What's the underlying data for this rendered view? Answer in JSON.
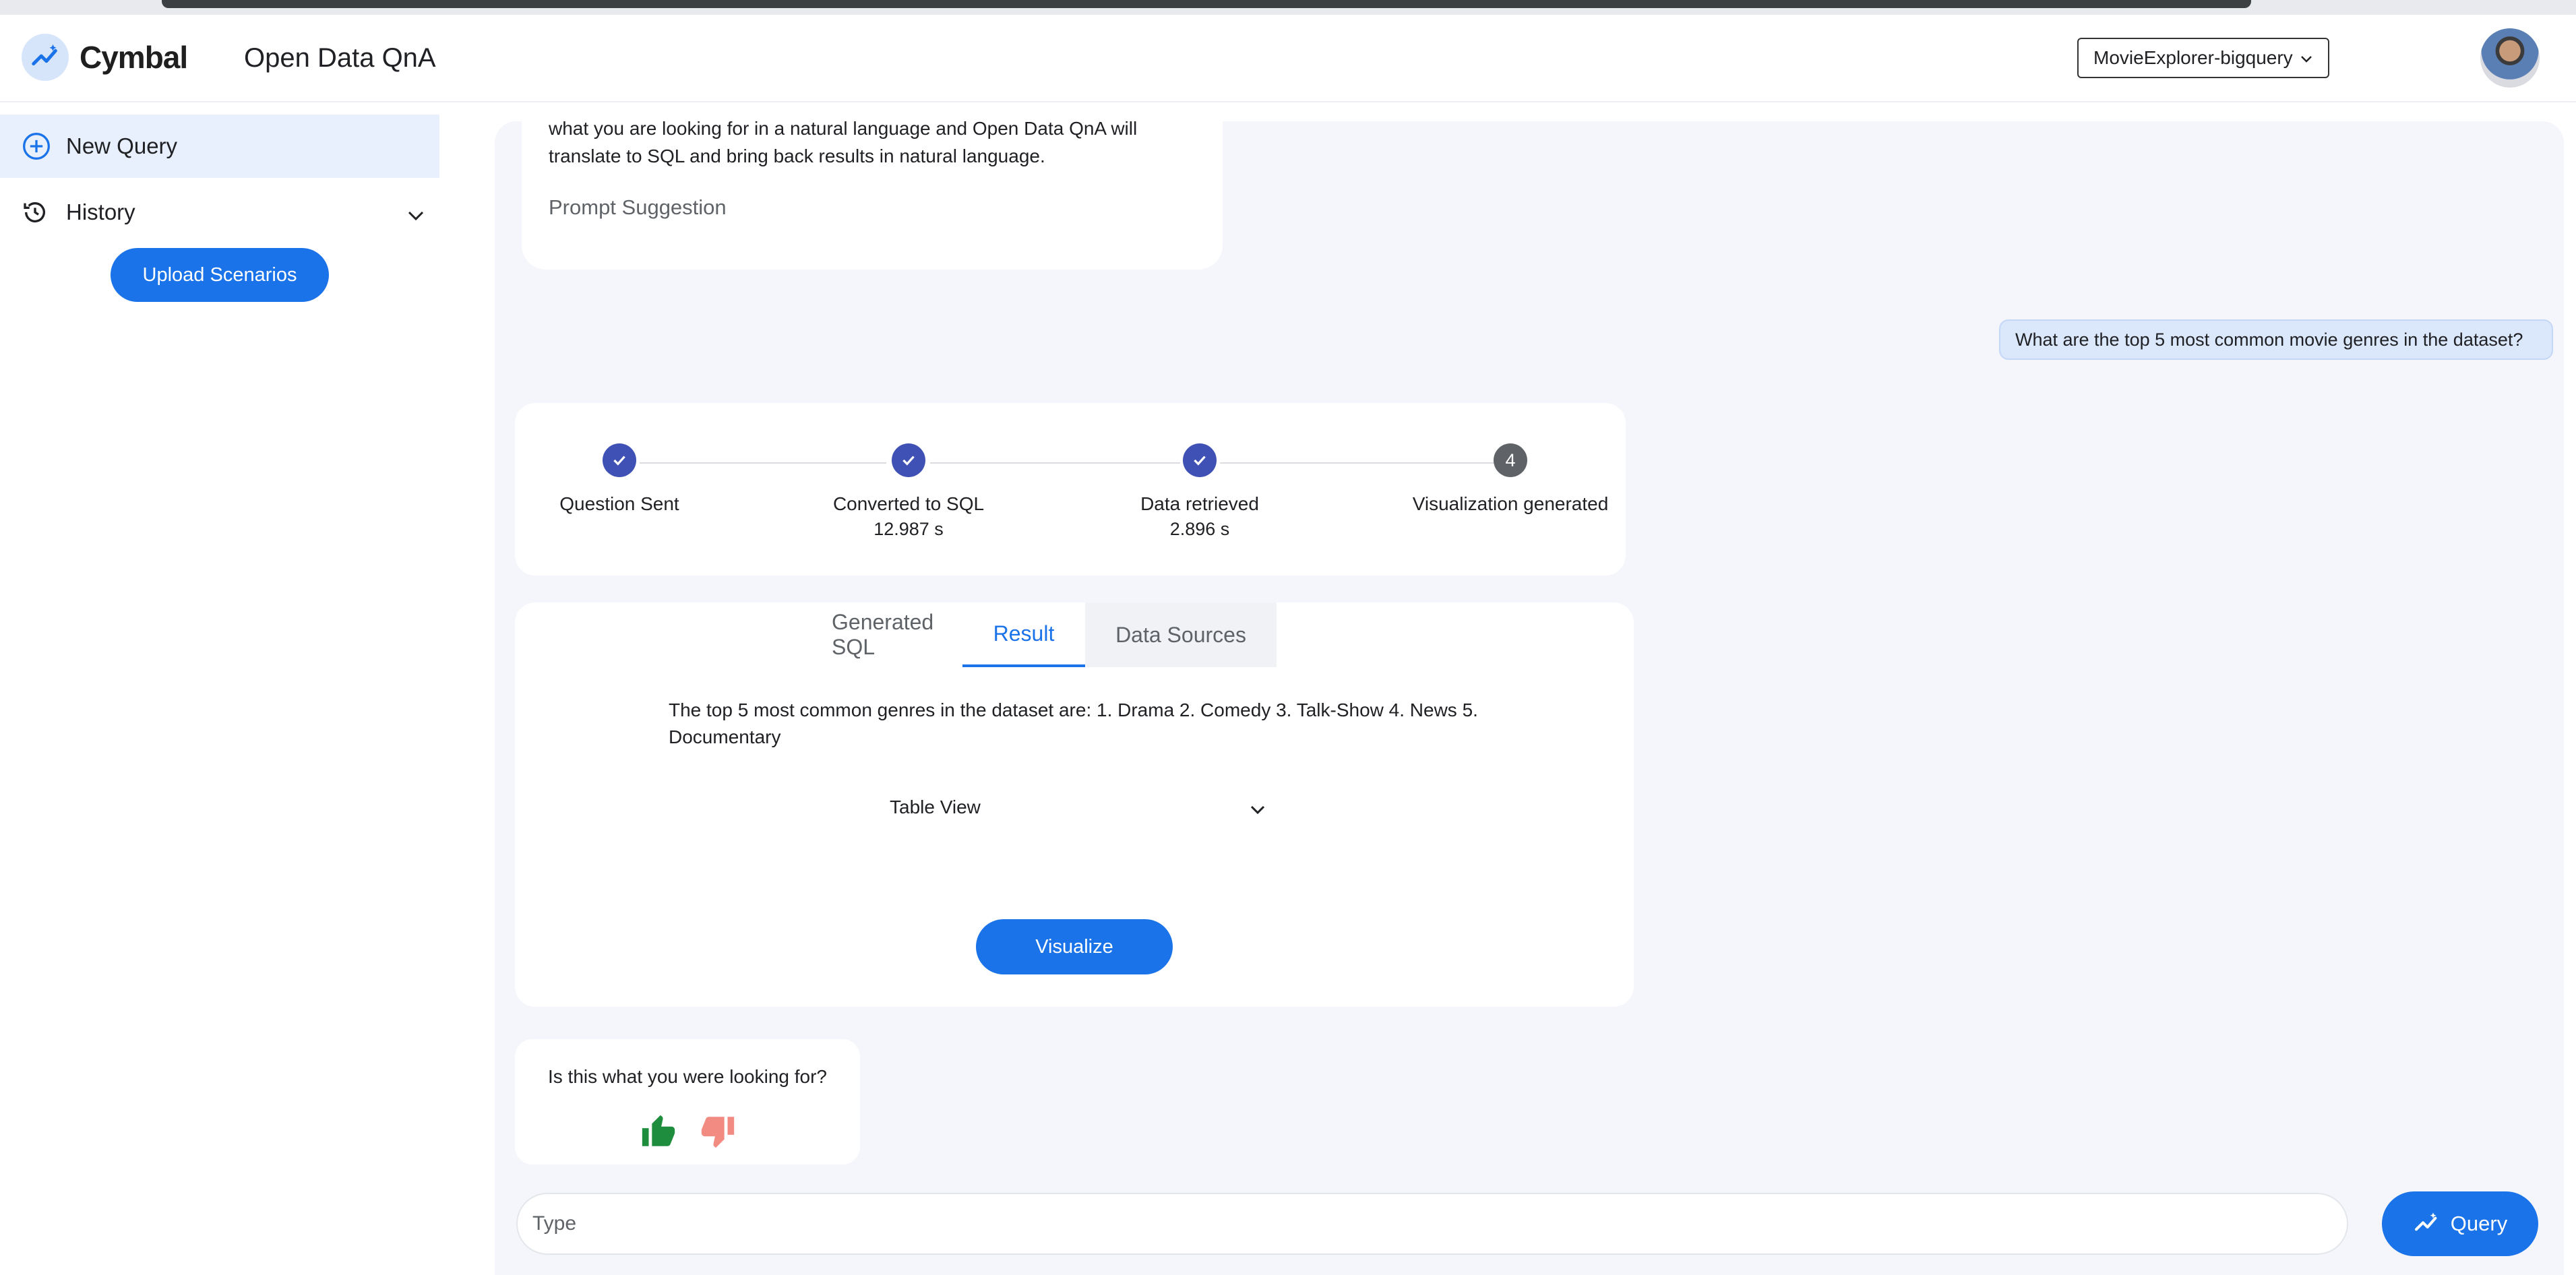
{
  "app": {
    "brand": "Cymbal",
    "title": "Open Data QnA",
    "datasource_selected": "MovieExplorer-bigquery"
  },
  "sidebar": {
    "new_query": "New Query",
    "history": "History",
    "upload": "Upload Scenarios"
  },
  "welcome": {
    "text": "what you are looking for in a natural language and Open Data QnA will translate to SQL and bring back results in natural language.",
    "prompt_suggestion": "Prompt Suggestion"
  },
  "user_message": "What are the top 5 most common movie genres in the dataset?",
  "progress": {
    "steps": [
      {
        "label": "Question Sent",
        "time": "",
        "status": "done"
      },
      {
        "label": "Converted to SQL",
        "time": "12.987 s",
        "status": "done"
      },
      {
        "label": "Data retrieved",
        "time": "2.896 s",
        "status": "done"
      },
      {
        "label": "Visualization generated",
        "time": "",
        "status": "pending",
        "number": "4"
      }
    ]
  },
  "result": {
    "tabs": [
      "Generated SQL",
      "Result",
      "Data Sources"
    ],
    "active_tab": "Result",
    "answer": "The top 5 most common genres in the dataset are: 1. Drama 2. Comedy 3. Talk-Show 4. News 5. Documentary",
    "view_select": "Table View",
    "visualize": "Visualize"
  },
  "feedback": {
    "question": "Is this what you were looking for?"
  },
  "input": {
    "placeholder": "Type",
    "submit": "Query"
  },
  "colors": {
    "accent": "#1a73e8",
    "step_done": "#3f51b5",
    "thumb_up": "#1e8e3e",
    "thumb_down": "#f28b82"
  }
}
